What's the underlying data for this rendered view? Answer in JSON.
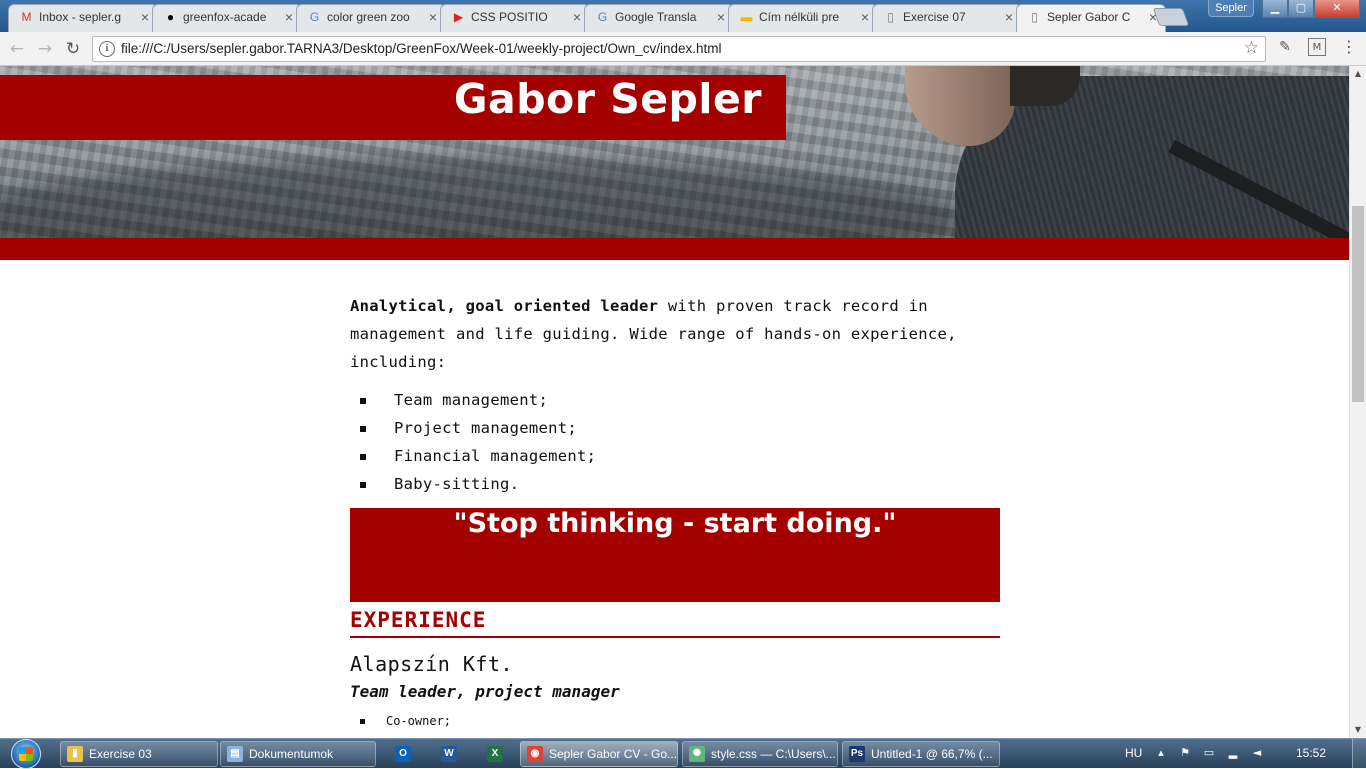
{
  "browser": {
    "tabs": [
      {
        "title": "Inbox - sepler.g",
        "icon": "gmail-icon",
        "glyph": "M",
        "color": "#d93025",
        "active": false
      },
      {
        "title": "greenfox-acade",
        "icon": "github-icon",
        "glyph": "●",
        "color": "#000000",
        "active": false
      },
      {
        "title": "color green zoo",
        "icon": "google-icon",
        "glyph": "G",
        "color": "#4285f4",
        "active": false
      },
      {
        "title": "CSS POSITIO",
        "icon": "youtube-icon",
        "glyph": "▶",
        "color": "#e62117",
        "active": false
      },
      {
        "title": "Google Transla",
        "icon": "google-translate-icon",
        "glyph": "G",
        "color": "#4a80e8",
        "active": false
      },
      {
        "title": "Cím nélküli pre",
        "icon": "google-slides-icon",
        "glyph": "▬",
        "color": "#f4b400",
        "active": false
      },
      {
        "title": "Exercise 07",
        "icon": "page-icon",
        "glyph": "▯",
        "color": "#777777",
        "active": false
      },
      {
        "title": "Sepler Gabor C",
        "icon": "page-icon",
        "glyph": "▯",
        "color": "#777777",
        "active": true
      }
    ],
    "profile_name": "Sepler",
    "url": "file:///C:/Users/sepler.gabor.TARNA3/Desktop/GreenFox/Week-01/weekly-project/Own_cv/index.html"
  },
  "page": {
    "name": "Gabor Sepler",
    "intro_bold": "Analytical, goal oriented leader",
    "intro_rest": " with proven track record in management and life guiding. Wide range of hands-on experience, including:",
    "skills": [
      "Team management;",
      "Project management;",
      "Financial management;",
      "Baby-sitting."
    ],
    "quote": "\"Stop thinking - start doing.\"",
    "experience_title": "EXPERIENCE",
    "company": "Alapszín Kft.",
    "role": "Team leader, project manager",
    "duties": [
      "Co-owner;"
    ],
    "accent_color": "#a50000"
  },
  "taskbar": {
    "tasks": [
      {
        "label": "Exercise 03",
        "icon": "folder-icon",
        "glyph": "▮",
        "color": "#e8c34d",
        "active": false
      },
      {
        "label": "Dokumentumok",
        "icon": "documents-icon",
        "glyph": "▤",
        "color": "#8fb4da",
        "active": false
      },
      {
        "label": "Sepler Gabor CV - Go...",
        "icon": "chrome-icon",
        "glyph": "◉",
        "color": "#db4437",
        "active": true
      },
      {
        "label": "style.css — C:\\Users\\...",
        "icon": "atom-icon",
        "glyph": "✺",
        "color": "#5fb57d",
        "active": false
      },
      {
        "label": "Untitled-1 @ 66,7% (...",
        "icon": "photoshop-icon",
        "glyph": "Ps",
        "color": "#1b3b6f",
        "active": false
      }
    ],
    "pinned": [
      {
        "icon": "outlook-icon",
        "glyph": "O",
        "color": "#0a64b4"
      },
      {
        "icon": "word-icon",
        "glyph": "W",
        "color": "#2b579a"
      },
      {
        "icon": "excel-icon",
        "glyph": "X",
        "color": "#217346"
      }
    ],
    "language": "HU",
    "clock": "15:52"
  }
}
